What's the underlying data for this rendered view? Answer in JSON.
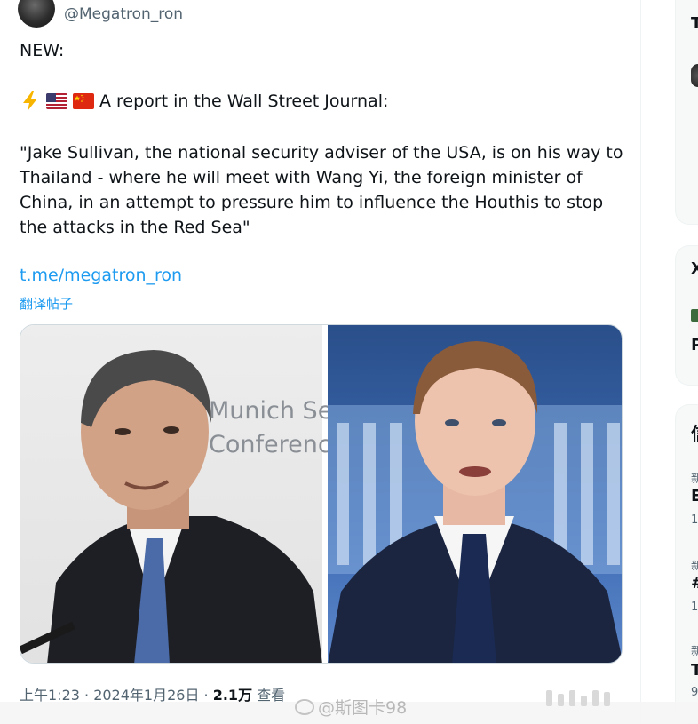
{
  "tweet": {
    "handle": "@Megatron_ron",
    "text_new": "NEW:",
    "report_text": "A report in the Wall Street Journal:",
    "emojis": [
      "lightning-icon",
      "us-flag-icon",
      "china-flag-icon"
    ],
    "quote": "\"Jake Sullivan, the national security adviser of the USA, is on his way to Thailand - where he will meet with Wang Yi, the foreign minister of China, in an attempt to pressure him to influence the Houthis to stop the attacks in the Red Sea\"",
    "link": "t.me/megatron_ron",
    "translate_label": "翻译帖子",
    "media": {
      "left_sign_line1": "Munich Se",
      "left_sign_line2": "Conferenc"
    },
    "meta": {
      "timestamp": "上午1:23 · 2024年1月26日 · ",
      "views_count": "2.1万",
      "views_label": " 查看"
    }
  },
  "watermark": {
    "text": "@斯图卡98"
  },
  "sidebar": {
    "card1_glyph": "T",
    "card2_glyph": "X",
    "card2_letter": "P",
    "card3_glyph": "信",
    "trend_items": [
      {
        "category": "新",
        "title": "E",
        "count": "1."
      },
      {
        "category": "新",
        "title": "#",
        "count": "1."
      },
      {
        "category": "新",
        "title": "T",
        "count": "9"
      }
    ]
  },
  "colors": {
    "accent": "#1d9bf0",
    "text": "#0f1419",
    "muted": "#536471"
  }
}
